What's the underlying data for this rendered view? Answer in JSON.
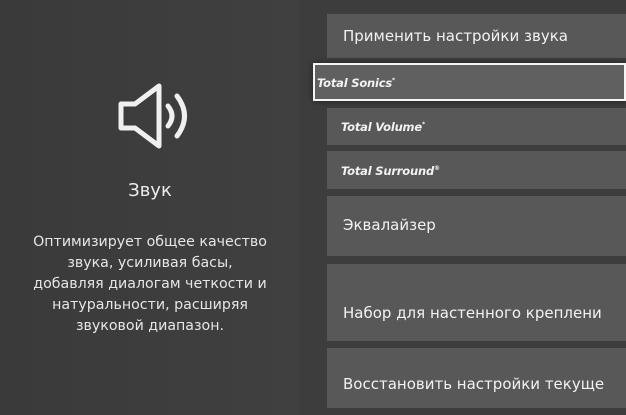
{
  "section": {
    "title": "Звук",
    "description": "Оптимизирует общее качество\nзвука, усиливая басы,\nдобавляя диалогам четкости и\nнатуральности, расширяя\nзвуковой диапазон.",
    "icon": "speaker-icon"
  },
  "menu": {
    "items": [
      {
        "label": "Применить настройки звука"
      },
      {
        "brand": "Total Sonics",
        "mark": "*",
        "focused": true
      },
      {
        "brand": "Total Volume",
        "mark": "*"
      },
      {
        "brand": "Total Surround",
        "mark": "®"
      },
      {
        "label": "Эквалайзер"
      },
      {
        "label": "Набор для настенного креплени"
      },
      {
        "label": "Восстановить настройки текуще"
      }
    ]
  },
  "colors": {
    "background": "#3b3b3b",
    "item": "#585858",
    "focus_border": "#f4f4f4",
    "text": "#f2f2f2"
  }
}
